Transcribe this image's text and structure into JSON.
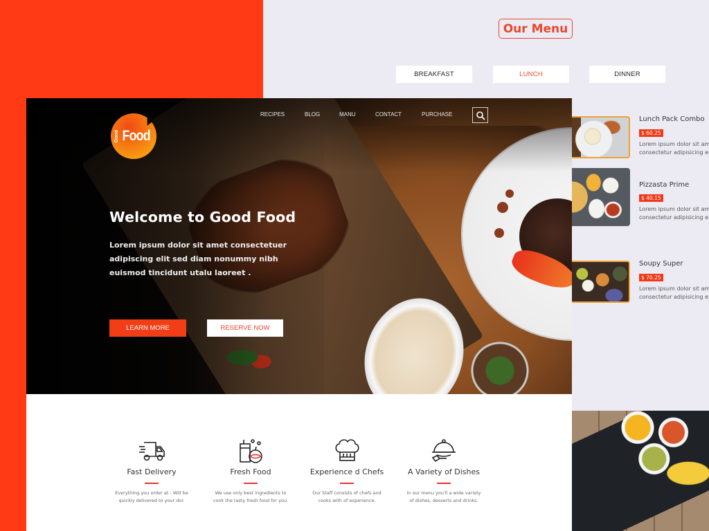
{
  "colors": {
    "brand_orange": "#FF3A14",
    "accent_red": "#E8472B",
    "price_red": "#F03A17",
    "background": "#ECEBF3",
    "thumb_border": "#F0A030"
  },
  "header": {
    "logo": {
      "small": "Good",
      "large": "Food"
    },
    "nav": [
      "RECIPES",
      "BLOG",
      "MANU",
      "CONTACT",
      "PURCHASE"
    ],
    "search_icon": "search-icon"
  },
  "hero": {
    "title": "Welcome to Good Food",
    "text_lines": [
      "Lorem ipsum dolor sit amet consectetuer",
      "adipiscing elit sed diam nonummy nibh",
      "euismod tincidunt utalu laoreet ."
    ],
    "learn_more": "LEARN MORE",
    "reserve_now": "RESERVE NOW"
  },
  "features": [
    {
      "icon": "delivery-truck-icon",
      "title": "Fast Delivery",
      "desc_lines": [
        "Everything you order at - Will be",
        "quickly delivered to your dor."
      ]
    },
    {
      "icon": "fresh-food-icon",
      "title": "Fresh Food",
      "desc_lines": [
        "We use only best ingredients to",
        "cook the tasty fresh food for you."
      ]
    },
    {
      "icon": "chef-hat-icon",
      "title": "Experience d Chefs",
      "desc_lines": [
        "Our Staff consists of chefs and",
        "cooks with of experience."
      ]
    },
    {
      "icon": "cloche-icon",
      "title": "A Variety of Dishes",
      "desc_lines": [
        "In our menu you'll a wide variety",
        "of dishes, desserts and drinks."
      ]
    }
  ],
  "menu": {
    "title": "Our Menu",
    "tabs": [
      {
        "label": "BREAKFAST",
        "active": false
      },
      {
        "label": "LUNCH",
        "active": true
      },
      {
        "label": "DINNER",
        "active": false
      }
    ],
    "items": [
      {
        "name": "Lunch Pack Combo",
        "price": "$ 60.25",
        "desc_lines": [
          "Lorem ipsum dolor sit amet",
          "consectetur adipisicing elit"
        ]
      },
      {
        "name": "Pizzasta Prime",
        "price": "$ 40.15",
        "desc_lines": [
          "Lorem ipsum dolor sit amet",
          "consectetur adipisicing elit"
        ]
      },
      {
        "name": "Soupy Super",
        "price": "$ 70.25",
        "desc_lines": [
          "Lorem ipsum dolor sit amet",
          "consectetur adipisicing elit"
        ]
      }
    ]
  }
}
